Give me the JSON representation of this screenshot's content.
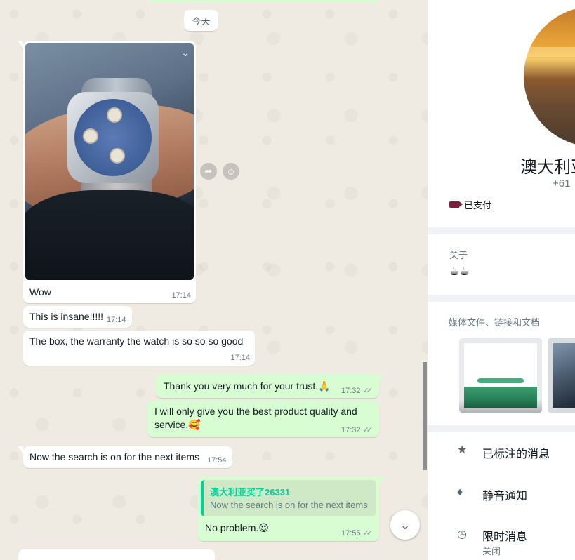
{
  "chat": {
    "date_chip": "今天",
    "messages": {
      "image": {
        "caption": "Wow",
        "time": "17:14"
      },
      "m1": {
        "text": "This is insane!!!!!",
        "time": "17:14"
      },
      "m2": {
        "text": "The box, the warranty the watch is so so so good",
        "time": "17:14"
      },
      "m3": {
        "text": "Thank you very much for your trust.🙏",
        "time": "17:32"
      },
      "m4_line1": "I will only give you the best product quality and",
      "m4_line2": "service.🥰",
      "m4_time": "17:32",
      "m5": {
        "text": "Now the search is on for the next items",
        "time": "17:54"
      },
      "m6": {
        "quote_author": "澳大利亚买了26331",
        "quote_text": "Now the search is on for the next items",
        "text": "No problem.😍",
        "time": "17:55"
      }
    },
    "icons": {
      "image_menu": "chevron-down-icon",
      "forward": "forward-icon",
      "react": "emoji-icon",
      "scroll_down": "chevron-down-icon",
      "read_ticks": "double-check-icon"
    }
  },
  "contact": {
    "name": "澳大利亚",
    "phone": "+61",
    "label": "已支付",
    "label_color": "#7a1f3d",
    "about_title": "关于",
    "about_value": "☕☕",
    "media_title": "媒体文件、链接和文档",
    "starred": "已标注的消息",
    "mute": "静音通知",
    "disappearing": "限时消息",
    "disappearing_status": "关闭"
  },
  "colors": {
    "outgoing": "#d9fdd3",
    "incoming": "#ffffff",
    "chat_bg": "#efeae2",
    "quote_accent": "#06cf9c"
  }
}
